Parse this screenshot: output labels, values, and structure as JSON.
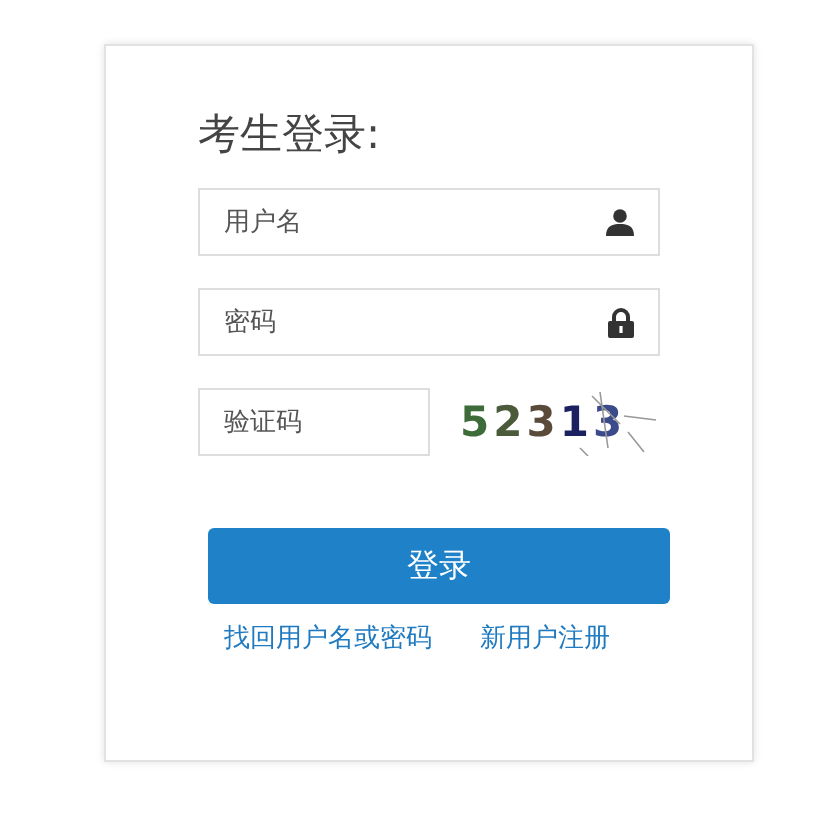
{
  "title": "考生登录:",
  "fields": [
    {
      "kind": "user",
      "placeholder": "用户名"
    },
    {
      "kind": "password",
      "placeholder": "密码"
    }
  ],
  "captcha": {
    "placeholder": "验证码",
    "code": "52313"
  },
  "login_button": "登录",
  "links": [
    "找回用户名或密码",
    "新用户注册"
  ]
}
